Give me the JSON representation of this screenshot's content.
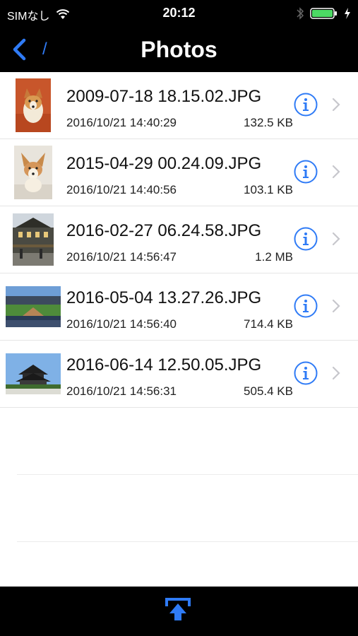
{
  "status": {
    "carrier": "SIMなし",
    "time": "20:12"
  },
  "nav": {
    "back_icon": "chevron-left-icon",
    "path": "/",
    "title": "Photos"
  },
  "files": [
    {
      "name": "2009-07-18 18.15.02.JPG",
      "date": "2016/10/21 14:40:29",
      "size": "132.5 KB",
      "thumb": "corgi-dog"
    },
    {
      "name": "2015-04-29 00.24.09.JPG",
      "date": "2016/10/21 14:40:56",
      "size": "103.1 KB",
      "thumb": "corgi-dog-white"
    },
    {
      "name": "2016-02-27 06.24.58.JPG",
      "date": "2016/10/21 14:56:47",
      "size": "1.2 MB",
      "thumb": "building-street"
    },
    {
      "name": "2016-05-04 13.27.26.JPG",
      "date": "2016/10/21 14:56:40",
      "size": "714.4 KB",
      "thumb": "baseball-stadium"
    },
    {
      "name": "2016-06-14 12.50.05.JPG",
      "date": "2016/10/21 14:56:31",
      "size": "505.4 KB",
      "thumb": "japanese-castle"
    }
  ],
  "toolbar": {
    "share_icon": "upload-share-icon"
  },
  "colors": {
    "accent": "#2f7bf6",
    "bar_bg": "#000000"
  }
}
